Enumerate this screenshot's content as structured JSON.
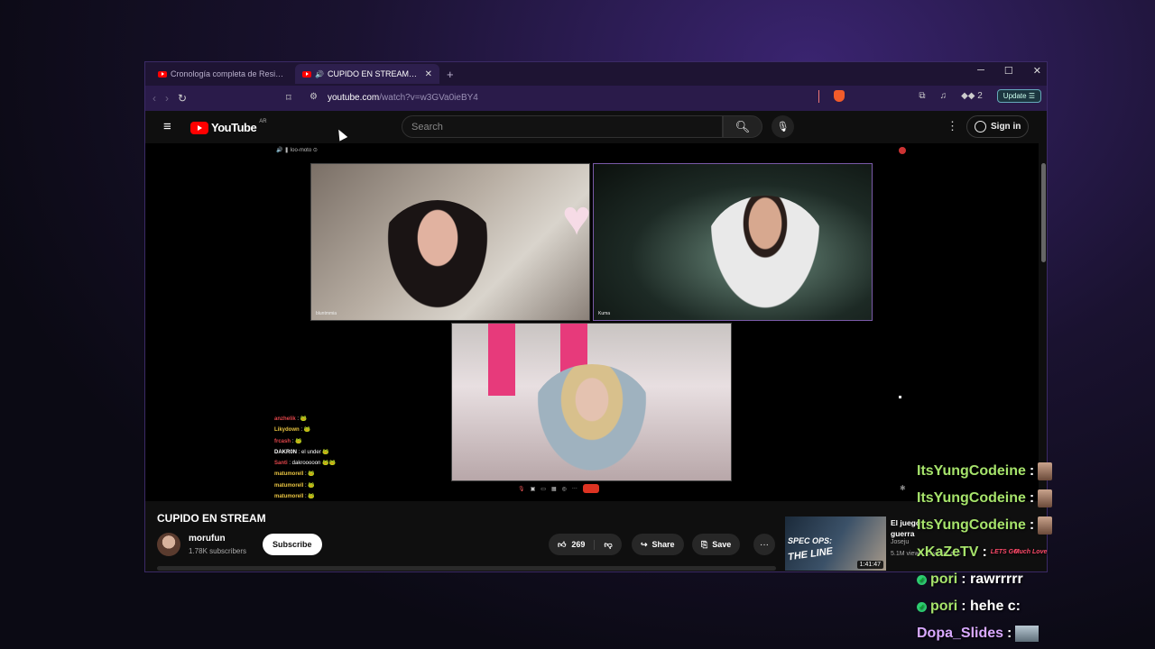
{
  "browser": {
    "tabs": [
      {
        "label": "Cronología completa de Resident Ev",
        "active": false
      },
      {
        "label": "CUPIDO EN STREAM - YouTu",
        "active": true
      }
    ],
    "url_host": "youtube.com",
    "url_path": "/watch?v=w3GVa0ieBY4",
    "update_label": "Update",
    "ext_count": "2"
  },
  "youtube": {
    "logo_text": "YouTube",
    "country_code": "AR",
    "search_placeholder": "Search",
    "signin_label": "Sign in"
  },
  "stream": {
    "overlay_label": "🔊 ❚ loo-moto ⊙",
    "cam1_name": "bluntmmia",
    "cam2_name": "Kuma",
    "mini_chat": [
      {
        "user": "anzhelik",
        "color": "#e0454a",
        "msg": ": 🐸"
      },
      {
        "user": "Likydown",
        "color": "#e8c341",
        "msg": ": 🐸"
      },
      {
        "user": "frcash",
        "color": "#e0454a",
        "msg": ": 🐸"
      },
      {
        "user": "DAKR0N",
        "color": "#ffffff",
        "msg": ": el under 🐸"
      },
      {
        "user": "Santi",
        "color": "#e0454a",
        "msg": ": dakrooooon 🐸🐸"
      },
      {
        "user": "matumorell",
        "color": "#e8c341",
        "msg": ": 🐸"
      },
      {
        "user": "matumorell",
        "color": "#e8c341",
        "msg": ": 🐸"
      },
      {
        "user": "matumorell",
        "color": "#e8c341",
        "msg": ": 🐸"
      }
    ]
  },
  "video": {
    "title": "CUPIDO EN STREAM",
    "channel": "morufun",
    "subscribers": "1.78K subscribers",
    "subscribe_label": "Subscribe",
    "likes": "269",
    "share_label": "Share",
    "save_label": "Save"
  },
  "suggestion": {
    "title": "El juego guerra",
    "channel": "Joseju",
    "meta": "5.1M views · 5 years ago",
    "thumb_line1": "SPEC OPS:",
    "thumb_line2": "THE LINE",
    "duration": "1:41:47"
  },
  "chat_overlay": [
    {
      "user": "ItsYungCodeine",
      "color": "#a6e36b",
      "sep": ":",
      "msg": ""
    },
    {
      "user": "ItsYungCodeine",
      "color": "#a6e36b",
      "sep": ":",
      "msg": ""
    },
    {
      "user": "ItsYungCodeine",
      "color": "#a6e36b",
      "sep": ":",
      "msg": ""
    },
    {
      "user": "xKaZeTV",
      "color": "#a6e36b",
      "sep": ":",
      "msg": ""
    },
    {
      "user": "pori",
      "color": "#a6e36b",
      "sep": ":",
      "msg": "rawrrrrr"
    },
    {
      "user": "pori",
      "color": "#a6e36b",
      "sep": ":",
      "msg": "hehe c:"
    },
    {
      "user": "Dopa_Slides",
      "color": "#d9a9ff",
      "sep": ":",
      "msg": ""
    }
  ],
  "chat_emote_text": {
    "lets_go": "LETS GO",
    "much_love": "Much Love"
  },
  "colors": {
    "yt_red": "#ff0000",
    "browser_purple": "#2a1b4a",
    "chat_green": "#a6e36b"
  }
}
